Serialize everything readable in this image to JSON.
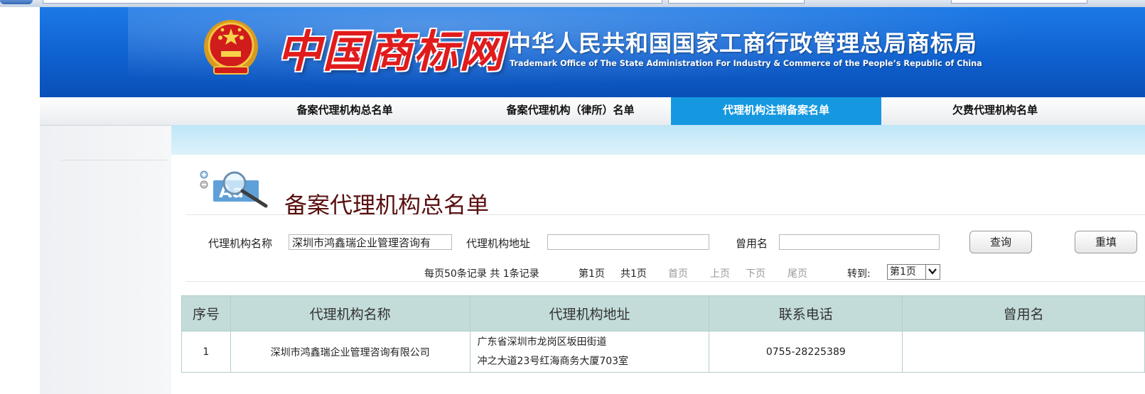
{
  "banner": {
    "logo_text": "中国商标网",
    "title_cn": "中华人民共和国国家工商行政管理总局商标局",
    "title_en": "Trademark Office of The State Administration For Industry & Commerce of the People’s Republic of China"
  },
  "nav": {
    "items": [
      {
        "label": "备案代理机构总名单",
        "active": false
      },
      {
        "label": "备案代理机构（律所）名单",
        "active": false
      },
      {
        "label": "代理机构注销备案名单",
        "active": true
      },
      {
        "label": "欠费代理机构名单",
        "active": false
      }
    ]
  },
  "page": {
    "heading": "备案代理机构总名单"
  },
  "search": {
    "name_label": "代理机构名称",
    "name_value": "深圳市鸿鑫瑞企业管理咨询有",
    "address_label": "代理机构地址",
    "address_value": "",
    "former_name_label": "曾用名",
    "former_name_value": "",
    "query_button": "查询",
    "reset_button": "重填"
  },
  "pager": {
    "summary": "每页50条记录 共 1条记录",
    "current_page": "第1页",
    "total_pages": "共1页",
    "first": "首页",
    "prev": "上页",
    "next": "下页",
    "last": "尾页",
    "goto_label": "转到:",
    "goto_value": "第1页"
  },
  "table": {
    "headers": [
      "序号",
      "代理机构名称",
      "代理机构地址",
      "联系电话",
      "曾用名"
    ],
    "rows": [
      {
        "index": "1",
        "name": "深圳市鸿鑫瑞企业管理咨询有限公司",
        "address_line1": "广东省深圳市龙岗区坂田街道",
        "address_line2": "冲之大道23号红海商务大厦703室",
        "phone": "0755-28225389",
        "former_name": ""
      }
    ]
  },
  "colors": {
    "banner_blue": "#0f61cf",
    "nav_active": "#1598e0",
    "table_header": "#c3dcd9",
    "heading": "#5a1010",
    "logo_red": "#e11b1b"
  },
  "icons": [
    "national-emblem-icon",
    "search-magnifier-icon",
    "chevron-down-icon"
  ]
}
